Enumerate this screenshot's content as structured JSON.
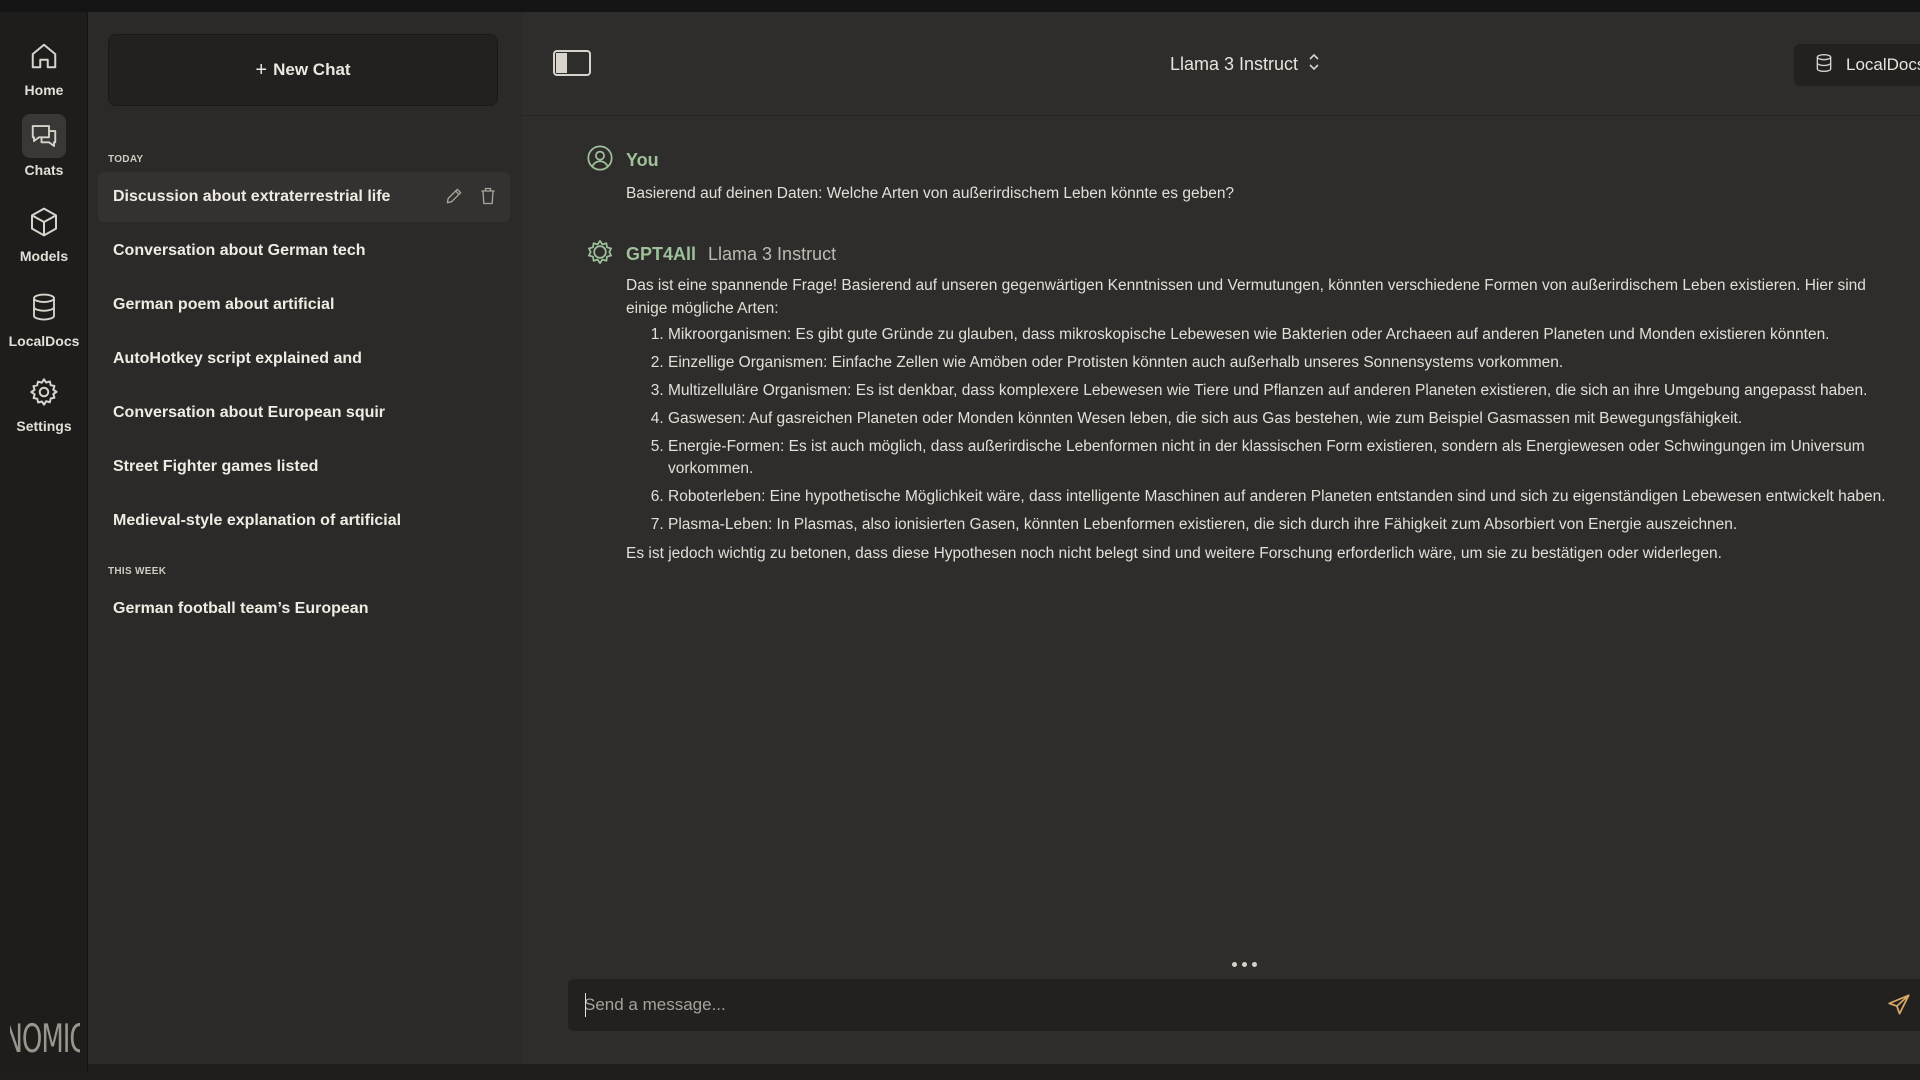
{
  "rail": {
    "items": [
      {
        "label": "Home",
        "icon": "home-icon"
      },
      {
        "label": "Chats",
        "icon": "chats-icon"
      },
      {
        "label": "Models",
        "icon": "models-icon"
      },
      {
        "label": "LocalDocs",
        "icon": "database-icon"
      },
      {
        "label": "Settings",
        "icon": "gear-icon"
      }
    ],
    "active": "Chats",
    "logo_text": "NOMIC"
  },
  "sidebar": {
    "new_chat_label": "New Chat",
    "sections": [
      {
        "label": "TODAY",
        "chats": [
          "Discussion about extraterrestrial life",
          "Conversation about German tech",
          "German poem about artificial",
          "AutoHotkey script explained and",
          "Conversation about European squir",
          "Street Fighter games listed",
          "Medieval-style explanation of artificial"
        ]
      },
      {
        "label": "THIS WEEK",
        "chats": [
          "German football team’s European"
        ]
      }
    ]
  },
  "header": {
    "model_name": "Llama 3 Instruct",
    "localdocs_label": "LocalDocs"
  },
  "conversation": {
    "user": {
      "author": "You",
      "text": "Basierend auf deinen Daten: Welche Arten von außerirdischem Leben könnte es geben?"
    },
    "assistant": {
      "author": "GPT4All",
      "model": "Llama 3 Instruct",
      "intro": "Das ist eine spannende Frage! Basierend auf unseren gegenwärtigen Kenntnissen und Vermutungen, könnten verschiedene Formen von außerirdischem Leben existieren. Hier sind einige mögliche Arten:",
      "items": [
        "Mikroorganismen: Es gibt gute Gründe zu glauben, dass mikroskopische Lebewesen wie Bakterien oder Archaeen auf anderen Planeten und Monden existieren könnten.",
        "Einzellige Organismen: Einfache Zellen wie Amöben oder Protisten könnten auch außerhalb unseres Sonnensystems vorkommen.",
        "Multizelluläre Organismen: Es ist denkbar, dass komplexere Lebewesen wie Tiere und Pflanzen auf anderen Planeten existieren, die sich an ihre Umgebung angepasst haben.",
        "Gaswesen: Auf gasreichen Planeten oder Monden könnten Wesen leben, die sich aus Gas bestehen, wie zum Beispiel Gasmassen mit Bewegungsfähigkeit.",
        "Energie-Formen: Es ist auch möglich, dass außerirdische Lebenformen nicht in der klassischen Form existieren, sondern als Energiewesen oder Schwingungen im Universum vorkommen.",
        "Roboterleben: Eine hypothetische Möglichkeit wäre, dass intelligente Maschinen auf anderen Planeten entstanden sind und sich zu eigenständigen Lebewesen entwickelt haben.",
        "Plasma-Leben: In Plasmas, also ionisierten Gasen, könnten Lebenformen existieren, die sich durch ihre Fähigkeit zum Absorbiert von Energie auszeichnen."
      ],
      "outro": "Es ist jedoch wichtig zu betonen, dass diese Hypothesen noch nicht belegt sind und weitere Forschung erforderlich wäre, um sie zu bestätigen oder widerlegen."
    }
  },
  "composer": {
    "placeholder": "Send a message...",
    "value": ""
  },
  "colors": {
    "accent_green": "#9ec09b",
    "background": "#2e2d2b",
    "sidebar": "#2b2a28",
    "rail": "#1e1d1c"
  }
}
